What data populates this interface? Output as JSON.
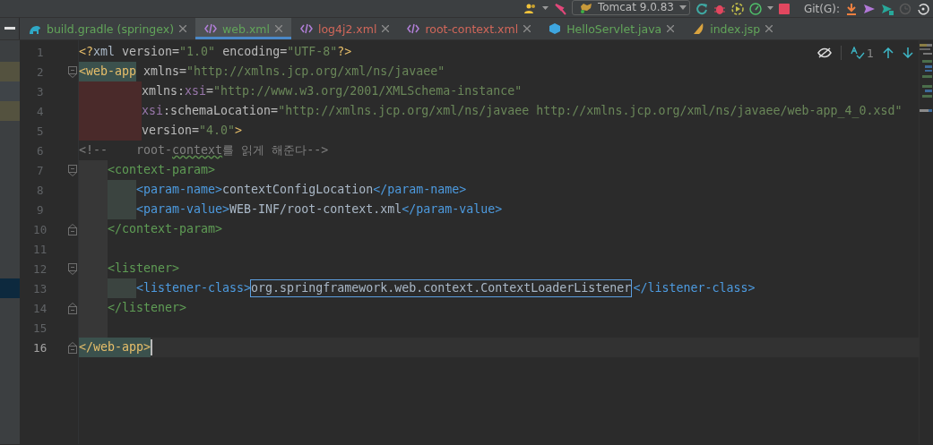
{
  "toolbar": {
    "run_config": "Tomcat 9.0.83",
    "vcs_label": "Git(G):",
    "history_disabled": true
  },
  "tabs": [
    {
      "label": "build.gradle (springex)",
      "kind": "gradle",
      "color": "#62a55a",
      "selected": false
    },
    {
      "label": "web.xml",
      "kind": "xml",
      "color": "#62a55a",
      "selected": true
    },
    {
      "label": "log4j2.xml",
      "kind": "xml",
      "color": "#d1675a",
      "selected": false
    },
    {
      "label": "root-context.xml",
      "kind": "xml",
      "color": "#d1675a",
      "selected": false
    },
    {
      "label": "HelloServlet.java",
      "kind": "java",
      "color": "#62a55a",
      "selected": false
    },
    {
      "label": "index.jsp",
      "kind": "jsp",
      "color": "#62a55a",
      "selected": false
    }
  ],
  "inspection": {
    "count": "1"
  },
  "lines": [
    {
      "number": "1",
      "current": false,
      "fold_start": false,
      "fold_end": false,
      "tokens": [
        {
          "kind": "prolog",
          "text": "<?"
        },
        {
          "kind": "text",
          "text": "xml "
        },
        {
          "kind": "attr",
          "text": "version="
        },
        {
          "kind": "string",
          "text": "\"1.0\""
        },
        {
          "kind": "attr",
          "text": " encoding="
        },
        {
          "kind": "string",
          "text": "\"UTF-8\""
        },
        {
          "kind": "prolog",
          "text": "?>"
        }
      ]
    },
    {
      "number": "2",
      "current": false,
      "fold_start": true,
      "fold_end": false,
      "marker": {
        "color": "#54523f"
      },
      "tokens": [
        {
          "kind": "root",
          "text": "<web-app",
          "match": true
        },
        {
          "kind": "attr",
          "text": " xmlns="
        },
        {
          "kind": "string",
          "text": "\"http://xmlns.jcp.org/xml/ns/javaee\""
        }
      ]
    },
    {
      "number": "3",
      "current": false,
      "fold_start": false,
      "fold_end": false,
      "marker": {
        "color": "#3f4448"
      },
      "tokens": [
        {
          "kind": "badindent"
        },
        {
          "kind": "attr",
          "text": "xmlns:"
        },
        {
          "kind": "ns",
          "text": "xsi"
        },
        {
          "kind": "attr",
          "text": "="
        },
        {
          "kind": "string",
          "text": "\"http://www.w3.org/2001/XMLSchema-instance\""
        }
      ]
    },
    {
      "number": "4",
      "current": false,
      "fold_start": false,
      "fold_end": false,
      "marker": {
        "color": "#54523f"
      },
      "tokens": [
        {
          "kind": "badindent"
        },
        {
          "kind": "ns",
          "text": "xsi"
        },
        {
          "kind": "attr",
          "text": ":schemaLocation="
        },
        {
          "kind": "string",
          "text": "\"http://xmlns.jcp.org/xml/ns/javaee http://xmlns.jcp.org/xml/ns/javaee/web-app_4_0.xsd\""
        }
      ]
    },
    {
      "number": "5",
      "current": false,
      "fold_start": false,
      "fold_end": false,
      "tokens": [
        {
          "kind": "badindent"
        },
        {
          "kind": "attr",
          "text": "version="
        },
        {
          "kind": "string",
          "text": "\"4.0\""
        },
        {
          "kind": "root",
          "text": ">"
        }
      ]
    },
    {
      "number": "6",
      "current": false,
      "fold_start": false,
      "fold_end": false,
      "tokens": [
        {
          "kind": "comment",
          "text": "<!--    root-"
        },
        {
          "kind": "comment",
          "text": "context",
          "typo": true
        },
        {
          "kind": "comment",
          "text": "를 읽게 해준다-->"
        }
      ]
    },
    {
      "number": "7",
      "current": false,
      "fold_start": true,
      "fold_end": false,
      "tokens": [
        {
          "kind": "guide"
        },
        {
          "kind": "outer",
          "text": "<context-param>"
        }
      ]
    },
    {
      "number": "8",
      "current": false,
      "fold_start": false,
      "fold_end": false,
      "tokens": [
        {
          "kind": "guide"
        },
        {
          "kind": "nested"
        },
        {
          "kind": "inner",
          "text": "<param-name>"
        },
        {
          "kind": "text",
          "text": "contextConfigLocation"
        },
        {
          "kind": "inner",
          "text": "</param-name>"
        }
      ]
    },
    {
      "number": "9",
      "current": false,
      "fold_start": false,
      "fold_end": false,
      "tokens": [
        {
          "kind": "guide"
        },
        {
          "kind": "nested"
        },
        {
          "kind": "inner",
          "text": "<param-value>"
        },
        {
          "kind": "text",
          "text": "WEB-INF/root-context.xml"
        },
        {
          "kind": "inner",
          "text": "</param-value>"
        }
      ]
    },
    {
      "number": "10",
      "current": false,
      "fold_start": false,
      "fold_end": true,
      "tokens": [
        {
          "kind": "guide"
        },
        {
          "kind": "outer",
          "text": "</context-param>"
        }
      ]
    },
    {
      "number": "11",
      "current": false,
      "fold_start": false,
      "fold_end": false,
      "tokens": [
        {
          "kind": "guide"
        }
      ]
    },
    {
      "number": "12",
      "current": false,
      "fold_start": true,
      "fold_end": false,
      "tokens": [
        {
          "kind": "guide"
        },
        {
          "kind": "outer",
          "text": "<listener>"
        }
      ]
    },
    {
      "number": "13",
      "current": false,
      "fold_start": false,
      "fold_end": false,
      "marker": {
        "color": "#0d293e"
      },
      "tokens": [
        {
          "kind": "guide"
        },
        {
          "kind": "nested"
        },
        {
          "kind": "inner",
          "text": "<listener-class>"
        },
        {
          "kind": "text",
          "text": "org.springframework.web.context.ContextLoaderListener",
          "boxed": true
        },
        {
          "kind": "inner",
          "text": "</listener-class>"
        }
      ]
    },
    {
      "number": "14",
      "current": false,
      "fold_start": false,
      "fold_end": true,
      "tokens": [
        {
          "kind": "guide"
        },
        {
          "kind": "outer",
          "text": "</listener>"
        }
      ]
    },
    {
      "number": "15",
      "current": false,
      "fold_start": false,
      "fold_end": false,
      "tokens": [
        {
          "kind": "guide"
        }
      ]
    },
    {
      "number": "16",
      "current": true,
      "fold_start": false,
      "fold_end": true,
      "tokens": [
        {
          "kind": "root",
          "text": "</web-app>",
          "match": true
        }
      ]
    }
  ]
}
